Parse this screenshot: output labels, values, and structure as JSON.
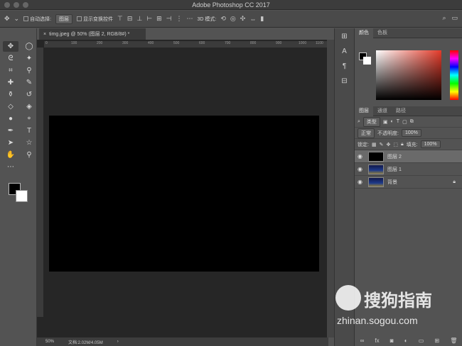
{
  "app_title": "Adobe Photoshop CC 2017",
  "options": {
    "auto_select_label": "自动选择:",
    "auto_select_value": "图层",
    "show_transform_label": "显示变换控件",
    "mode_3d": "3D 模式:"
  },
  "document_tab": {
    "label": "timg.jpeg @ 50% (图层 2, RGB/8#) *"
  },
  "ruler_ticks": [
    "0",
    "100",
    "200",
    "300",
    "400",
    "500",
    "600",
    "700",
    "800",
    "900",
    "1000",
    "1100"
  ],
  "status": {
    "zoom": "50%",
    "doc_size": "文档:2.02M/4.05M"
  },
  "color_panel": {
    "tabs": [
      "颜色",
      "色板"
    ],
    "foreground": "#000000",
    "background": "#ffffff"
  },
  "layers_panel": {
    "tabs": [
      "图层",
      "通道",
      "路径"
    ],
    "filter_label": "类型",
    "blend_mode": "正常",
    "opacity_label": "不透明度:",
    "opacity_value": "100%",
    "lock_label": "锁定:",
    "fill_label": "填充:",
    "fill_value": "100%",
    "layers": [
      {
        "name": "图层 2",
        "selected": true
      },
      {
        "name": "图层 1",
        "selected": false
      },
      {
        "name": "背景",
        "selected": false,
        "locked": true
      }
    ]
  },
  "watermark": {
    "brand": "搜狗指南",
    "url": "zhinan.sogou.com"
  }
}
